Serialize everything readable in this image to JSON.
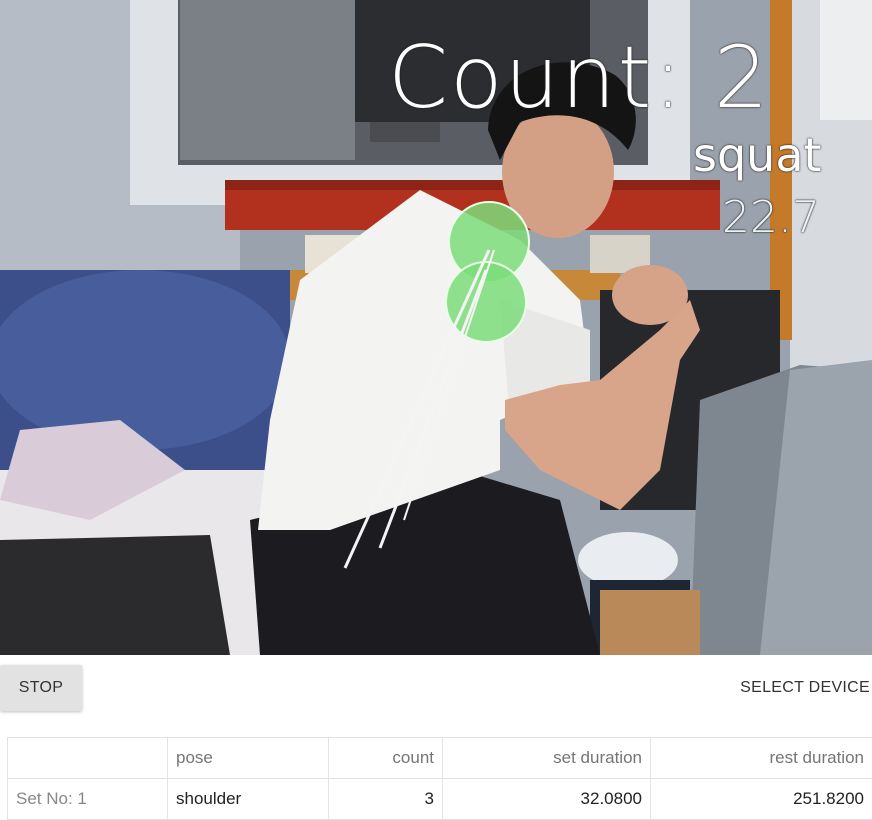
{
  "overlay": {
    "count_label": "Count:  2",
    "exercise": "squat",
    "timer": "22.7"
  },
  "controls": {
    "stop_label": "STOP",
    "select_device_label": "SELECT DEVICE"
  },
  "table": {
    "headers": [
      "",
      "pose",
      "count",
      "set duration",
      "rest duration"
    ],
    "rows": [
      [
        "Set No: 1",
        "shoulder",
        "3",
        "32.0800",
        "251.8200"
      ]
    ]
  },
  "colors": {
    "keypoint": "#7ddc7a",
    "skeleton_line": "#f4f4f4"
  }
}
